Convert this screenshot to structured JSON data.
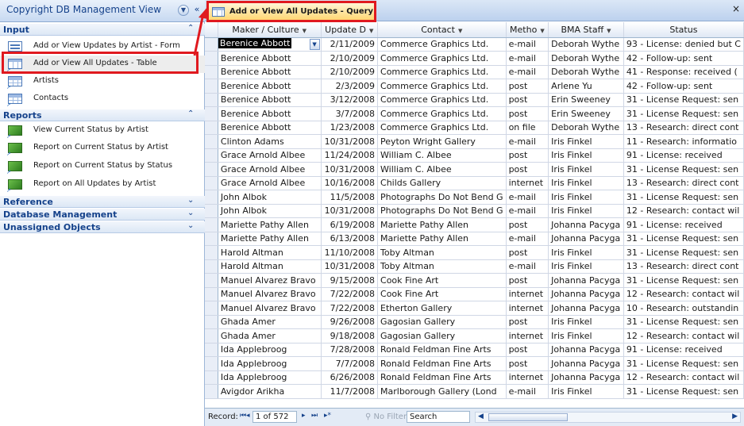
{
  "nav": {
    "title": "Copyright DB Management View",
    "dropdown_icon": "chevron-down-circle-icon",
    "close_icon": "close-icon",
    "groups": [
      {
        "label": "Input",
        "items": [
          {
            "label": "Add or View Updates by Artist - Form",
            "icon": "form-icon"
          },
          {
            "label": "Add or View All Updates - Table",
            "icon": "query-icon"
          },
          {
            "label": "Artists",
            "icon": "table-icon"
          },
          {
            "label": "Contacts",
            "icon": "table-icon"
          }
        ]
      },
      {
        "label": "Reports",
        "items": [
          {
            "label": "View Current Status by Artist",
            "icon": "report-icon"
          },
          {
            "label": "Report on Current Status by Artist",
            "icon": "report-icon"
          },
          {
            "label": "Report on Current Status by Status",
            "icon": "report-icon"
          },
          {
            "label": "Report on All Updates by Artist",
            "icon": "report-icon"
          }
        ]
      },
      {
        "label": "Reference",
        "items": []
      },
      {
        "label": "Database Management",
        "items": []
      },
      {
        "label": "Unassigned Objects",
        "items": []
      }
    ]
  },
  "doc": {
    "tab_label": "Add or View All Updates - Query",
    "close": "×"
  },
  "grid": {
    "columns": [
      "Maker / Culture",
      "Update D",
      "Contact",
      "Metho",
      "BMA Staff",
      "Status"
    ],
    "rows": [
      [
        "Berenice Abbott",
        "2/11/2009",
        "Commerce Graphics Ltd.",
        "e-mail",
        "Deborah Wythe",
        "93 - License: denied but C"
      ],
      [
        "Berenice Abbott",
        "2/10/2009",
        "Commerce Graphics Ltd.",
        "e-mail",
        "Deborah Wythe",
        "42 - Follow-up: sent"
      ],
      [
        "Berenice Abbott",
        "2/10/2009",
        "Commerce Graphics Ltd.",
        "e-mail",
        "Deborah Wythe",
        "41 - Response: received ("
      ],
      [
        "Berenice Abbott",
        "2/3/2009",
        "Commerce Graphics Ltd.",
        "post",
        "Arlene Yu",
        "42 - Follow-up: sent"
      ],
      [
        "Berenice Abbott",
        "3/12/2008",
        "Commerce Graphics Ltd.",
        "post",
        "Erin Sweeney",
        "31 - License Request: sen"
      ],
      [
        "Berenice Abbott",
        "3/7/2008",
        "Commerce Graphics Ltd.",
        "post",
        "Erin Sweeney",
        "31 - License Request: sen"
      ],
      [
        "Berenice Abbott",
        "1/23/2008",
        "Commerce Graphics Ltd.",
        "on file",
        "Deborah Wythe",
        "13 - Research: direct cont"
      ],
      [
        "Clinton Adams",
        "10/31/2008",
        "Peyton Wright Gallery",
        "e-mail",
        "Iris Finkel",
        "11 - Research: informatio"
      ],
      [
        "Grace Arnold Albee",
        "11/24/2008",
        "William C. Albee",
        "post",
        "Iris Finkel",
        "91 - License: received"
      ],
      [
        "Grace Arnold Albee",
        "10/31/2008",
        "William C. Albee",
        "post",
        "Iris Finkel",
        "31 - License Request: sen"
      ],
      [
        "Grace Arnold Albee",
        "10/16/2008",
        "Childs Gallery",
        "internet",
        "Iris Finkel",
        "13 - Research: direct cont"
      ],
      [
        "John Albok",
        "11/5/2008",
        "Photographs Do Not Bend G",
        "e-mail",
        "Iris Finkel",
        "31 - License Request: sen"
      ],
      [
        "John Albok",
        "10/31/2008",
        "Photographs Do Not Bend G",
        "e-mail",
        "Iris Finkel",
        "12 - Research: contact wil"
      ],
      [
        "Mariette Pathy Allen",
        "6/19/2008",
        "Mariette Pathy Allen",
        "post",
        "Johanna Pacyga",
        "91 - License: received"
      ],
      [
        "Mariette Pathy Allen",
        "6/13/2008",
        "Mariette Pathy Allen",
        "e-mail",
        "Johanna Pacyga",
        "31 - License Request: sen"
      ],
      [
        "Harold Altman",
        "11/10/2008",
        "Toby Altman",
        "post",
        "Iris Finkel",
        "31 - License Request: sen"
      ],
      [
        "Harold Altman",
        "10/31/2008",
        "Toby Altman",
        "e-mail",
        "Iris Finkel",
        "13 - Research: direct cont"
      ],
      [
        "Manuel Alvarez Bravo",
        "9/15/2008",
        "Cook Fine Art",
        "post",
        "Johanna Pacyga",
        "31 - License Request: sen"
      ],
      [
        "Manuel Alvarez Bravo",
        "7/22/2008",
        "Cook Fine Art",
        "internet",
        "Johanna Pacyga",
        "12 - Research: contact wil"
      ],
      [
        "Manuel Alvarez Bravo",
        "7/22/2008",
        "Etherton Gallery",
        "internet",
        "Johanna Pacyga",
        "10 - Research: outstandin"
      ],
      [
        "Ghada Amer",
        "9/26/2008",
        "Gagosian Gallery",
        "post",
        "Iris Finkel",
        "31 - License Request: sen"
      ],
      [
        "Ghada Amer",
        "9/18/2008",
        "Gagosian Gallery",
        "internet",
        "Iris Finkel",
        "12 - Research: contact wil"
      ],
      [
        "Ida Applebroog",
        "7/28/2008",
        "Ronald Feldman Fine Arts",
        "post",
        "Johanna Pacyga",
        "91 - License: received"
      ],
      [
        "Ida Applebroog",
        "7/7/2008",
        "Ronald Feldman Fine Arts",
        "post",
        "Johanna Pacyga",
        "31 - License Request: sen"
      ],
      [
        "Ida Applebroog",
        "6/26/2008",
        "Ronald Feldman Fine Arts",
        "internet",
        "Johanna Pacyga",
        "12 - Research: contact wil"
      ],
      [
        "Avigdor Arikha",
        "11/7/2008",
        "Marlborough Gallery (Lond",
        "e-mail",
        "Iris Finkel",
        "31 - License Request: sen"
      ]
    ]
  },
  "statusbar": {
    "record_label": "Record:",
    "first_icon": "first-record-icon",
    "prev_icon": "prev-record-icon",
    "position": "1 of 572",
    "next_icon": "next-record-icon",
    "last_icon": "last-record-icon",
    "new_icon": "new-record-icon",
    "filter": "No Filter",
    "search": "Search"
  },
  "colors": {
    "highlight": "#e0191f",
    "accent": "#15428b"
  }
}
